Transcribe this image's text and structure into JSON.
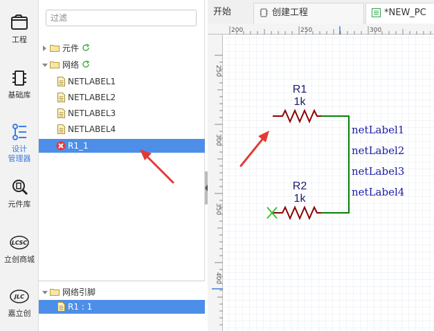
{
  "rail": {
    "items": [
      {
        "label": "工程",
        "icon": "project-folder-icon"
      },
      {
        "label": "基础库",
        "icon": "chip-icon"
      },
      {
        "label": "设计",
        "label2": "管理器",
        "icon": "design-manager-icon"
      },
      {
        "label": "元件库",
        "icon": "component-search-icon"
      },
      {
        "label": "立创商城",
        "icon": "lcsc-logo-icon"
      },
      {
        "label": "嘉立创",
        "icon": "jlc-logo-icon"
      }
    ]
  },
  "panel": {
    "filter_placeholder": "过滤",
    "tree": {
      "components_folder": "元件",
      "nets_folder": "网络",
      "netlabels": [
        "NETLABEL1",
        "NETLABEL2",
        "NETLABEL3",
        "NETLABEL4"
      ],
      "error_item": "R1_1"
    },
    "bottom": {
      "folder": "网络引脚",
      "item": "R1 : 1"
    }
  },
  "tabs": [
    {
      "label": "开始"
    },
    {
      "label": "创建工程",
      "icon": "project-tab-icon"
    },
    {
      "label": "*NEW_PC",
      "icon": "schematic-tab-icon"
    }
  ],
  "canvas": {
    "ruler_top": [
      "200",
      "250",
      "300"
    ],
    "ruler_left": [
      "250",
      "300",
      "350",
      "400"
    ],
    "r1": {
      "name": "R1",
      "value": "1k"
    },
    "r2": {
      "name": "R2",
      "value": "1k"
    },
    "net_labels": [
      "netLabel1",
      "netLabel2",
      "netLabel3",
      "netLabel4"
    ]
  },
  "colors": {
    "accent": "#4d8fe8",
    "wire": "#008000",
    "resistor": "#8b0000",
    "netlabel": "#1a1aa6",
    "annotation": "#e53935"
  }
}
